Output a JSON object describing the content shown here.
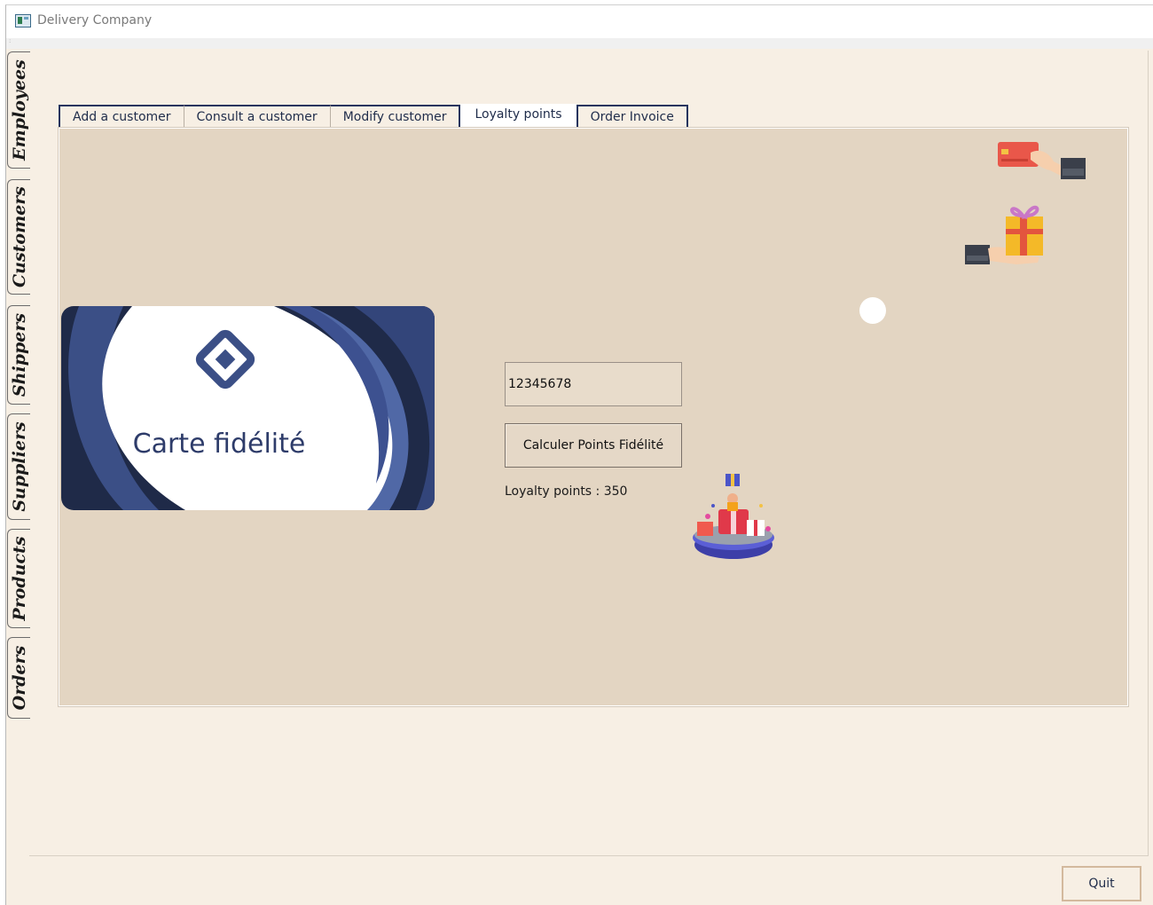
{
  "window": {
    "title": "Delivery Company"
  },
  "side_tabs": [
    "Employees",
    "Customers",
    "Shippers",
    "Suppliers",
    "Products",
    "Orders"
  ],
  "tabs": [
    {
      "label": "Add a customer",
      "active": false
    },
    {
      "label": "Consult a customer",
      "active": false
    },
    {
      "label": "Modify customer",
      "active": false
    },
    {
      "label": "Loyalty points",
      "active": true
    },
    {
      "label": "Order Invoice",
      "active": false
    }
  ],
  "loyalty": {
    "card_title": "Carte fidélité",
    "customer_id_value": "12345678",
    "calc_button": "Calculer Points Fidélité",
    "result_label": "Loyalty points : 350"
  },
  "footer": {
    "quit_label": "Quit"
  },
  "colors": {
    "accent": "#23345e",
    "pane": "#e3d5c2",
    "background": "#f7efe4",
    "card_navy": "#1f2a48"
  }
}
